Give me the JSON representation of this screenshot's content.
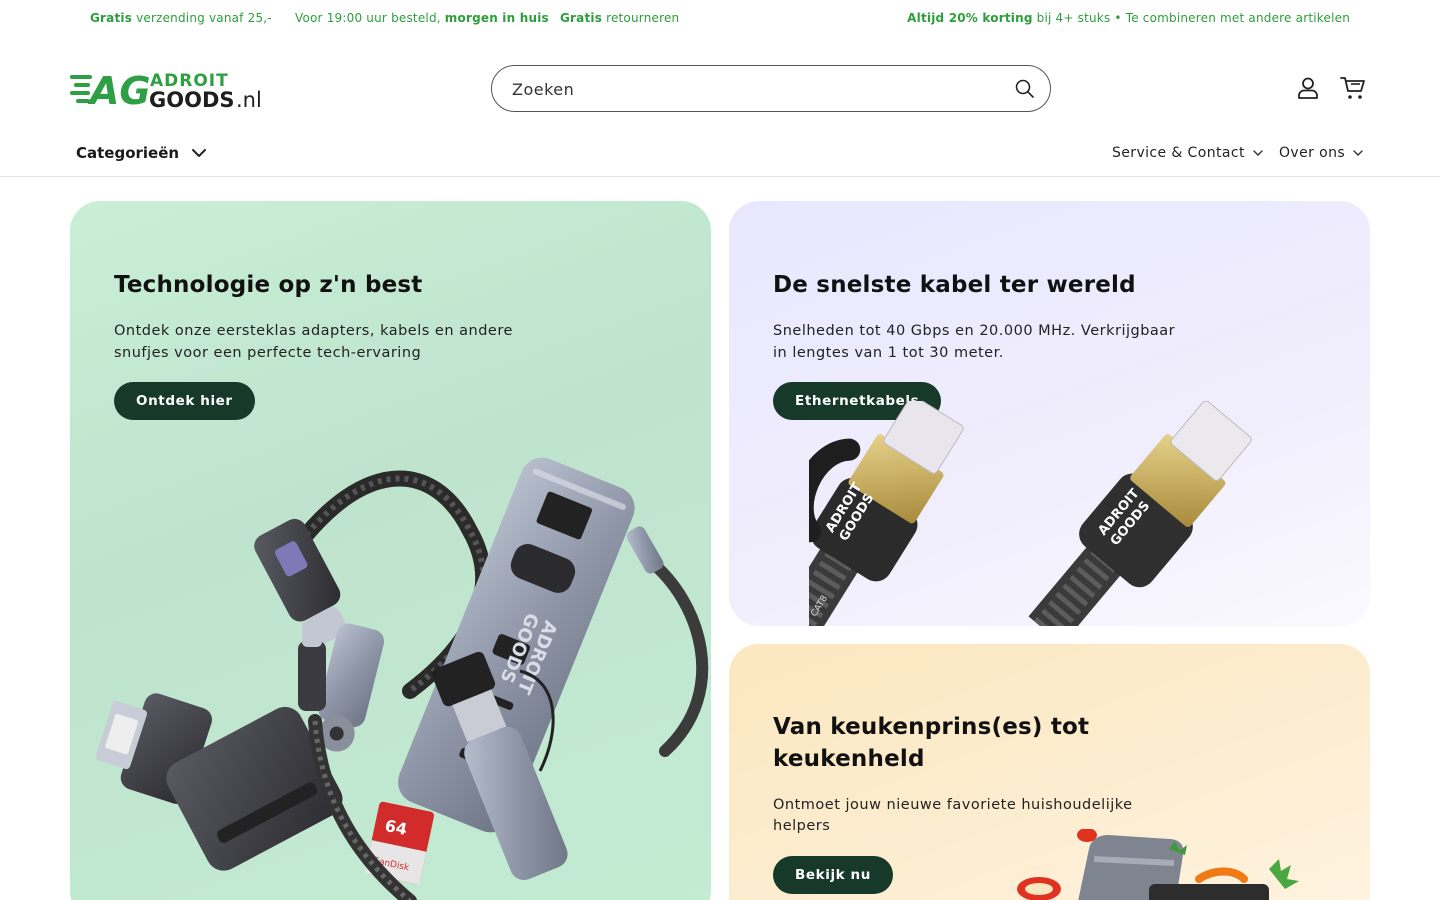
{
  "announcement": {
    "left": [
      {
        "bold": "Gratis",
        "text": " verzending vanaf 25,-"
      },
      {
        "text": "Voor 19:00 uur besteld, ",
        "bold": "morgen in huis"
      },
      {
        "bold": "Gratis",
        "text": " retourneren"
      }
    ],
    "right": {
      "bold": "Altijd 20% korting",
      "text": " bij 4+ stuks • Te combineren met andere artikelen"
    }
  },
  "header": {
    "logo_top": "ADROIT",
    "logo_bottom": "GOODS",
    "logo_tld": ".nl",
    "search_placeholder": "Zoeken"
  },
  "nav": {
    "categories_label": "Categorieën",
    "service_label": "Service & Contact",
    "about_label": "Over ons"
  },
  "cards": [
    {
      "title": "Technologie op z'n best",
      "text_line1": "Ontdek onze eersteklas adapters, kabels en andere",
      "text_line2": "snufjes voor een perfecte tech-ervaring",
      "button": "Ontdek hier"
    },
    {
      "title": "De snelste kabel ter wereld",
      "text_line1": "Snelheden tot 40 Gbps en 20.000 MHz. Verkrijgbaar",
      "text_line2": "in lengtes van 1 tot 30 meter.",
      "button": "Ethernetkabels"
    },
    {
      "title_line1": "Van keukenprins(es) tot",
      "title_line2": "keukenheld",
      "text_line1": "Ontmoet jouw nieuwe favoriete huishoudelijke",
      "text_line2": "helpers",
      "button": "Bekijk nu"
    }
  ],
  "product_labels": {
    "brand_top": "ADROIT",
    "brand_bottom": "GOODS",
    "cable_cat": "CAT8",
    "sd_brand": "SanDisk",
    "sd_size": "64"
  },
  "colors": {
    "announcement_green": "#2d9e3c",
    "logo_green": "#2ea043",
    "button_dark_green": "#17392a",
    "card_green": "#c9efd6",
    "card_lavender": "#e9e7ff",
    "card_peach": "#fbe7bf"
  },
  "icons": [
    "search-icon",
    "account-icon",
    "cart-icon",
    "chevron-down-icon"
  ]
}
